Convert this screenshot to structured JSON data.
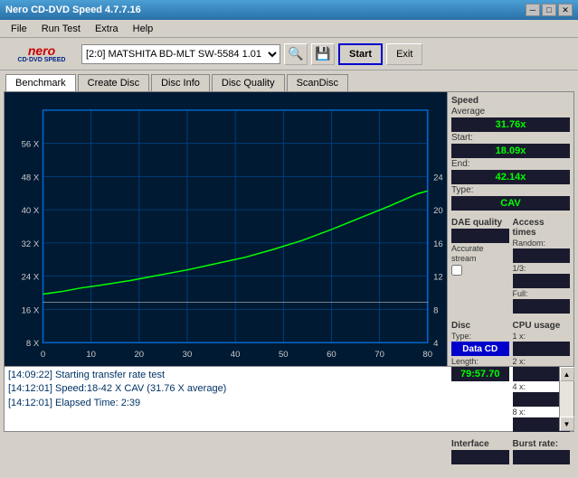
{
  "window": {
    "title": "Nero CD-DVD Speed 4.7.7.16",
    "min_btn": "─",
    "max_btn": "□",
    "close_btn": "✕"
  },
  "menu": {
    "items": [
      "File",
      "Run Test",
      "Extra",
      "Help"
    ]
  },
  "toolbar": {
    "drive_value": "[2:0]  MATSHITA BD-MLT SW-5584 1.01",
    "start_label": "Start",
    "exit_label": "Exit"
  },
  "tabs": {
    "items": [
      "Benchmark",
      "Create Disc",
      "Disc Info",
      "Disc Quality",
      "ScanDisc"
    ],
    "active": 0
  },
  "speed_panel": {
    "title": "Speed",
    "average_label": "Average",
    "average_value": "31.76x",
    "start_label": "Start:",
    "start_value": "18.09x",
    "end_label": "End:",
    "end_value": "42.14x",
    "type_label": "Type:",
    "type_value": "CAV"
  },
  "access_panel": {
    "title": "Access times",
    "random_label": "Random:",
    "random_value": "",
    "one_third_label": "1/3:",
    "one_third_value": "",
    "full_label": "Full:",
    "full_value": ""
  },
  "cpu_panel": {
    "title": "CPU usage",
    "x1_label": "1 x:",
    "x1_value": "",
    "x2_label": "2 x:",
    "x2_value": "",
    "x4_label": "4 x:",
    "x4_value": "",
    "x8_label": "8 x:",
    "x8_value": ""
  },
  "dae_panel": {
    "title": "DAE quality",
    "value": "",
    "accurate_label": "Accurate",
    "stream_label": "stream",
    "checked": false
  },
  "disc_panel": {
    "title": "Disc",
    "type_label": "Type:",
    "type_value": "Data CD",
    "length_label": "Length:",
    "length_value": "79:57.70",
    "interface_label": "Interface",
    "burst_label": "Burst rate:"
  },
  "chart": {
    "x_labels": [
      "0",
      "10",
      "20",
      "30",
      "40",
      "50",
      "60",
      "70",
      "80"
    ],
    "y_left_labels": [
      "8 X",
      "16 X",
      "24 X",
      "32 X",
      "40 X",
      "48 X",
      "56 X"
    ],
    "y_right_labels": [
      "4",
      "8",
      "12",
      "16",
      "20",
      "24"
    ]
  },
  "log": {
    "entries": [
      "[14:09:22]  Starting transfer rate test",
      "[14:12:01]  Speed:18-42 X CAV (31.76 X average)",
      "[14:12:01]  Elapsed Time: 2:39"
    ]
  }
}
